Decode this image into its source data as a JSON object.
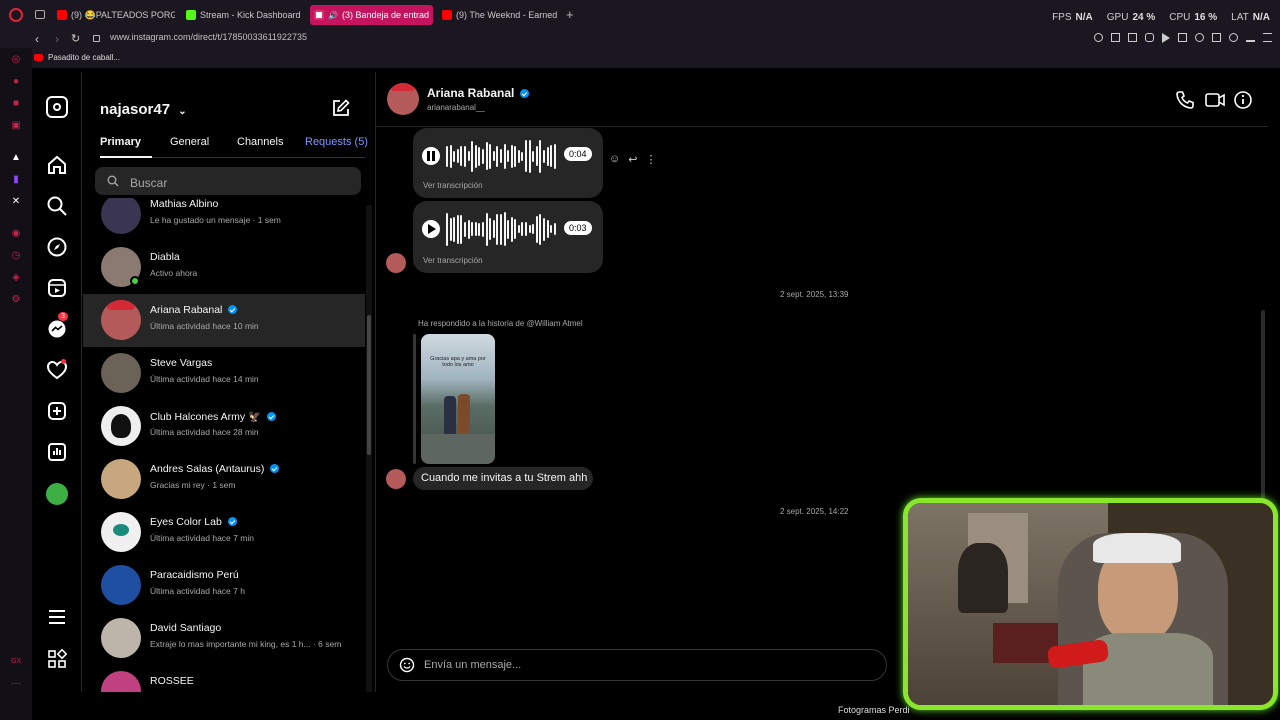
{
  "browser": {
    "tabs": [
      {
        "label": "(9) 😂PALTEADOS PORG",
        "color": "#ff0000"
      },
      {
        "label": "Stream - Kick Dashboard",
        "color": "#53fc18"
      },
      {
        "label": "(3) Bandeja de entrad",
        "color": "#e1306c"
      },
      {
        "label": "(9) The Weeknd - Earned",
        "color": "#ff0000"
      }
    ],
    "url": "www.instagram.com/direct/t/17850033611922735",
    "bookmark": "Pasadito de caball...",
    "hud": [
      {
        "key": "FPS",
        "value": "N/A"
      },
      {
        "key": "GPU",
        "value": "24 %"
      },
      {
        "key": "CPU",
        "value": "16 %"
      },
      {
        "key": "LAT",
        "value": "N/A"
      }
    ]
  },
  "nav": {
    "notification_count": "3"
  },
  "dm": {
    "username": "najasor47",
    "tabs": [
      "Primary",
      "General",
      "Channels",
      "Requests (5)"
    ],
    "search_placeholder": "Buscar",
    "conversations": [
      {
        "name": "Mathias Albino",
        "sub": "Le ha gustado un mensaje · 1 sem",
        "color": "#3a3550"
      },
      {
        "name": "Diabla",
        "sub": "Activo ahora",
        "color": "#8a7a70"
      },
      {
        "name": "Ariana Rabanal",
        "sub": "Última actividad hace 10 min",
        "color": "#b55a5a"
      },
      {
        "name": "Steve Vargas",
        "sub": "Última actividad hace 14 min",
        "color": "#6b6258"
      },
      {
        "name": "Club Halcones Army 🦅",
        "sub": "Última actividad hace 28 min",
        "color": "#eeeeee"
      },
      {
        "name": "Andres Salas (Antaurus)",
        "sub": "Gracias mi rey · 1 sem",
        "color": "#c7a77e"
      },
      {
        "name": "Eyes Color Lab",
        "sub": "Última actividad hace 7 min",
        "color": "#f0f0f0"
      },
      {
        "name": "Paracaidismo Perú",
        "sub": "Última actividad hace 7 h",
        "color": "#1e4fa0"
      },
      {
        "name": "David Santiago",
        "sub": "Extraje lo mas importante mi king, es 1 h... · 6 sem",
        "color": "#bdb5aa"
      },
      {
        "name": "ROSSEE",
        "sub": "",
        "color": "#c04080"
      }
    ]
  },
  "chat": {
    "contact_name": "Ariana Rabanal",
    "contact_handle": "arianarabanal__",
    "audio1_duration": "0:04",
    "audio2_duration": "0:03",
    "transcription_label": "Ver transcripción",
    "timestamp1": "2 sept. 2025, 13:39",
    "story_reply_label": "Ha respondido a la historia de @William Atmel",
    "story_text": "Gracias apa y ama por todo los amo",
    "message": "Cuando me invitas a tu Strem ahh",
    "timestamp2": "2 sept. 2025, 14:22",
    "composer_placeholder": "Envía un mensaje..."
  },
  "overlay": {
    "fotogramas": "Fotogramas Perdi"
  }
}
